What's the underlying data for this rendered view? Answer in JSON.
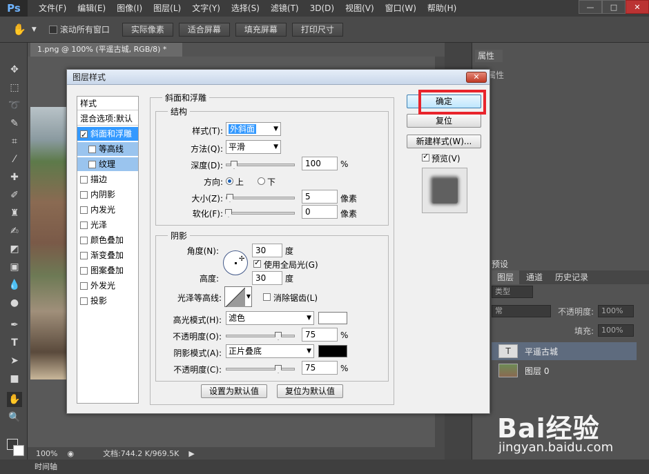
{
  "app": {
    "logo": "Ps",
    "menus": [
      "文件(F)",
      "编辑(E)",
      "图像(I)",
      "图层(L)",
      "文字(Y)",
      "选择(S)",
      "滤镜(T)",
      "3D(D)",
      "视图(V)",
      "窗口(W)",
      "帮助(H)"
    ],
    "window_controls": [
      "—",
      "□",
      "✕"
    ]
  },
  "options_bar": {
    "scroll_all_label": "滚动所有窗口",
    "buttons": [
      "实际像素",
      "适合屏幕",
      "填充屏幕",
      "打印尺寸"
    ]
  },
  "document": {
    "tab_title": "1.png @ 100% (平遥古城, RGB/8) *",
    "zoom": "100%",
    "doc_info": "文档:744.2 K/969.5K"
  },
  "timeline_label": "时间轴",
  "right_panels": {
    "properties_tab": "属性",
    "properties_label": "属性",
    "presets_label": "预设",
    "layer_tabs": [
      "图层",
      "通道",
      "历史记录"
    ],
    "kind_label": "类型",
    "blend_value": "常",
    "opacity_label": "不透明度:",
    "opacity_value": "100%",
    "fill_label": "填充:",
    "fill_value": "100%",
    "layers": [
      {
        "name": "平遥古城",
        "thumb": "T",
        "selected": true
      },
      {
        "name": "图层 0",
        "thumb": "",
        "selected": false
      }
    ]
  },
  "dialog": {
    "title": "图层样式",
    "close": "✕",
    "style_list": {
      "header": "样式",
      "blend_options": "混合选项:默认",
      "items": [
        {
          "label": "斜面和浮雕",
          "checked": true,
          "selected": true,
          "sub": false
        },
        {
          "label": "等高线",
          "checked": false,
          "selected": false,
          "sub": true
        },
        {
          "label": "纹理",
          "checked": false,
          "selected": false,
          "sub": true
        },
        {
          "label": "描边",
          "checked": false,
          "selected": false,
          "sub": false
        },
        {
          "label": "内阴影",
          "checked": false,
          "selected": false,
          "sub": false
        },
        {
          "label": "内发光",
          "checked": false,
          "selected": false,
          "sub": false
        },
        {
          "label": "光泽",
          "checked": false,
          "selected": false,
          "sub": false
        },
        {
          "label": "颜色叠加",
          "checked": false,
          "selected": false,
          "sub": false
        },
        {
          "label": "渐变叠加",
          "checked": false,
          "selected": false,
          "sub": false
        },
        {
          "label": "图案叠加",
          "checked": false,
          "selected": false,
          "sub": false
        },
        {
          "label": "外发光",
          "checked": false,
          "selected": false,
          "sub": false
        },
        {
          "label": "投影",
          "checked": false,
          "selected": false,
          "sub": false
        }
      ]
    },
    "bevel": {
      "section_title": "斜面和浮雕",
      "structure_title": "结构",
      "style_label": "样式(T):",
      "style_value": "外斜面",
      "technique_label": "方法(Q):",
      "technique_value": "平滑",
      "depth_label": "深度(D):",
      "depth_value": "100",
      "depth_unit": "%",
      "direction_label": "方向:",
      "direction_up": "上",
      "direction_down": "下",
      "size_label": "大小(Z):",
      "size_value": "5",
      "size_unit": "像素",
      "soften_label": "软化(F):",
      "soften_value": "0",
      "soften_unit": "像素"
    },
    "shading": {
      "title": "阴影",
      "angle_label": "角度(N):",
      "angle_value": "30",
      "angle_unit": "度",
      "global_light_label": "使用全局光(G)",
      "altitude_label": "高度:",
      "altitude_value": "30",
      "altitude_unit": "度",
      "gloss_label": "光泽等高线:",
      "anti_alias_label": "消除锯齿(L)",
      "highlight_mode_label": "高光模式(H):",
      "highlight_mode_value": "滤色",
      "highlight_color": "#ffffff",
      "highlight_opacity_label": "不透明度(O):",
      "highlight_opacity_value": "75",
      "shadow_mode_label": "阴影模式(A):",
      "shadow_mode_value": "正片叠底",
      "shadow_color": "#000000",
      "shadow_opacity_label": "不透明度(C):",
      "shadow_opacity_value": "75",
      "percent": "%"
    },
    "make_default": "设置为默认值",
    "reset_default": "复位为默认值",
    "ok": "确定",
    "reset": "复位",
    "new_style": "新建样式(W)...",
    "preview_label": "预览(V)"
  },
  "watermark": {
    "brand": "Bai经验",
    "url": "jingyan.baidu.com"
  }
}
